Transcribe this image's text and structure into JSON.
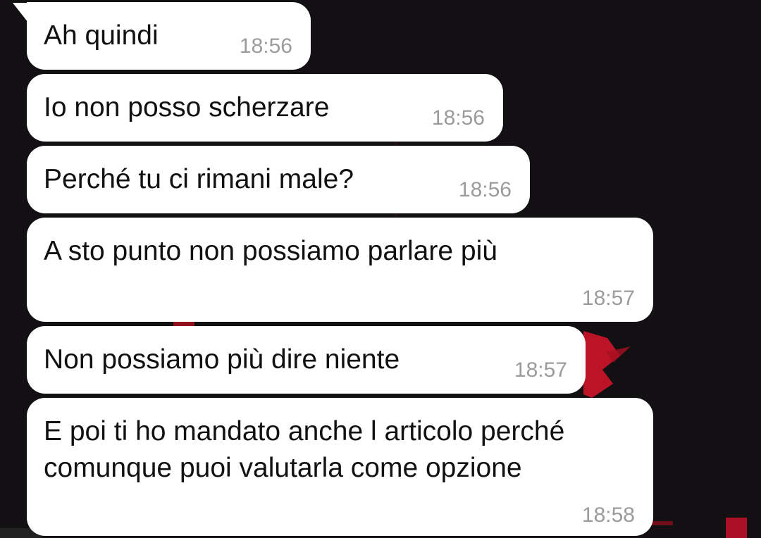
{
  "chat": {
    "messages": [
      {
        "text": "Ah quindi",
        "time": "18:56"
      },
      {
        "text": "Io non posso scherzare",
        "time": "18:56"
      },
      {
        "text": "Perché tu ci rimani male?",
        "time": "18:56"
      },
      {
        "text": "A sto punto non possiamo parlare più",
        "time": "18:57"
      },
      {
        "text": "Non possiamo più dire niente",
        "time": "18:57"
      },
      {
        "text": "E poi ti ho mandato anche l articolo perché comunque puoi valutarla come opzione",
        "time": "18:58"
      }
    ]
  },
  "colors": {
    "background": "#121013",
    "bubble": "#ffffff",
    "text": "#111111",
    "time": "#9b9b9b",
    "wallpaper_accent": "#c8102e"
  }
}
